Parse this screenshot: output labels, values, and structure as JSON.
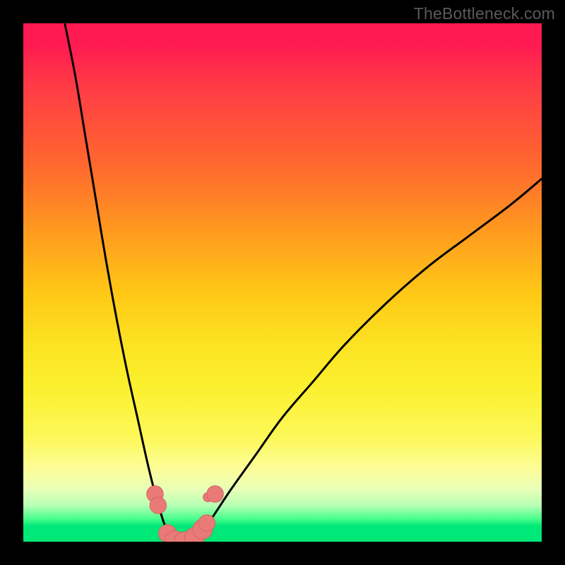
{
  "watermark": "TheBottleneck.com",
  "colors": {
    "curve": "#000000",
    "marker_fill": "#e97a77",
    "marker_stroke": "#d56561",
    "background_black": "#000000"
  },
  "chart_data": {
    "type": "line",
    "title": "",
    "xlabel": "",
    "ylabel": "",
    "xlim": [
      0,
      100
    ],
    "ylim": [
      0,
      100
    ],
    "grid": false,
    "legend": false,
    "series": [
      {
        "name": "left-curve",
        "x": [
          8,
          10,
          12,
          14,
          16,
          18,
          20,
          22,
          24,
          25.5,
          27,
          28,
          28.7
        ],
        "y": [
          100,
          90,
          78,
          66,
          54,
          43,
          33,
          24,
          15,
          9,
          4,
          1.5,
          0
        ]
      },
      {
        "name": "right-curve",
        "x": [
          32.5,
          34,
          36,
          40,
          45,
          50,
          56,
          62,
          70,
          78,
          86,
          94,
          100
        ],
        "y": [
          0,
          1.5,
          4,
          10,
          17,
          24,
          31,
          38,
          46,
          53,
          59,
          65,
          70
        ]
      },
      {
        "name": "floor-segment",
        "x": [
          28.7,
          32.5
        ],
        "y": [
          0,
          0
        ]
      }
    ],
    "markers": [
      {
        "x": 25.4,
        "y": 9.2,
        "r": 1.6
      },
      {
        "x": 26.0,
        "y": 7.0,
        "r": 1.6
      },
      {
        "x": 27.8,
        "y": 1.6,
        "r": 1.7
      },
      {
        "x": 29.2,
        "y": 0.2,
        "r": 1.9
      },
      {
        "x": 31.0,
        "y": 0.0,
        "r": 1.9
      },
      {
        "x": 33.0,
        "y": 0.8,
        "r": 1.9
      },
      {
        "x": 34.6,
        "y": 2.4,
        "r": 1.9
      },
      {
        "x": 35.4,
        "y": 3.6,
        "r": 1.6
      },
      {
        "x": 35.6,
        "y": 8.6,
        "r": 0.9
      },
      {
        "x": 37.0,
        "y": 9.2,
        "r": 1.6
      }
    ],
    "note": "Axes have no visible tick labels; x/y are normalized 0–100 over the plotting area. Values estimated from pixel positions."
  }
}
